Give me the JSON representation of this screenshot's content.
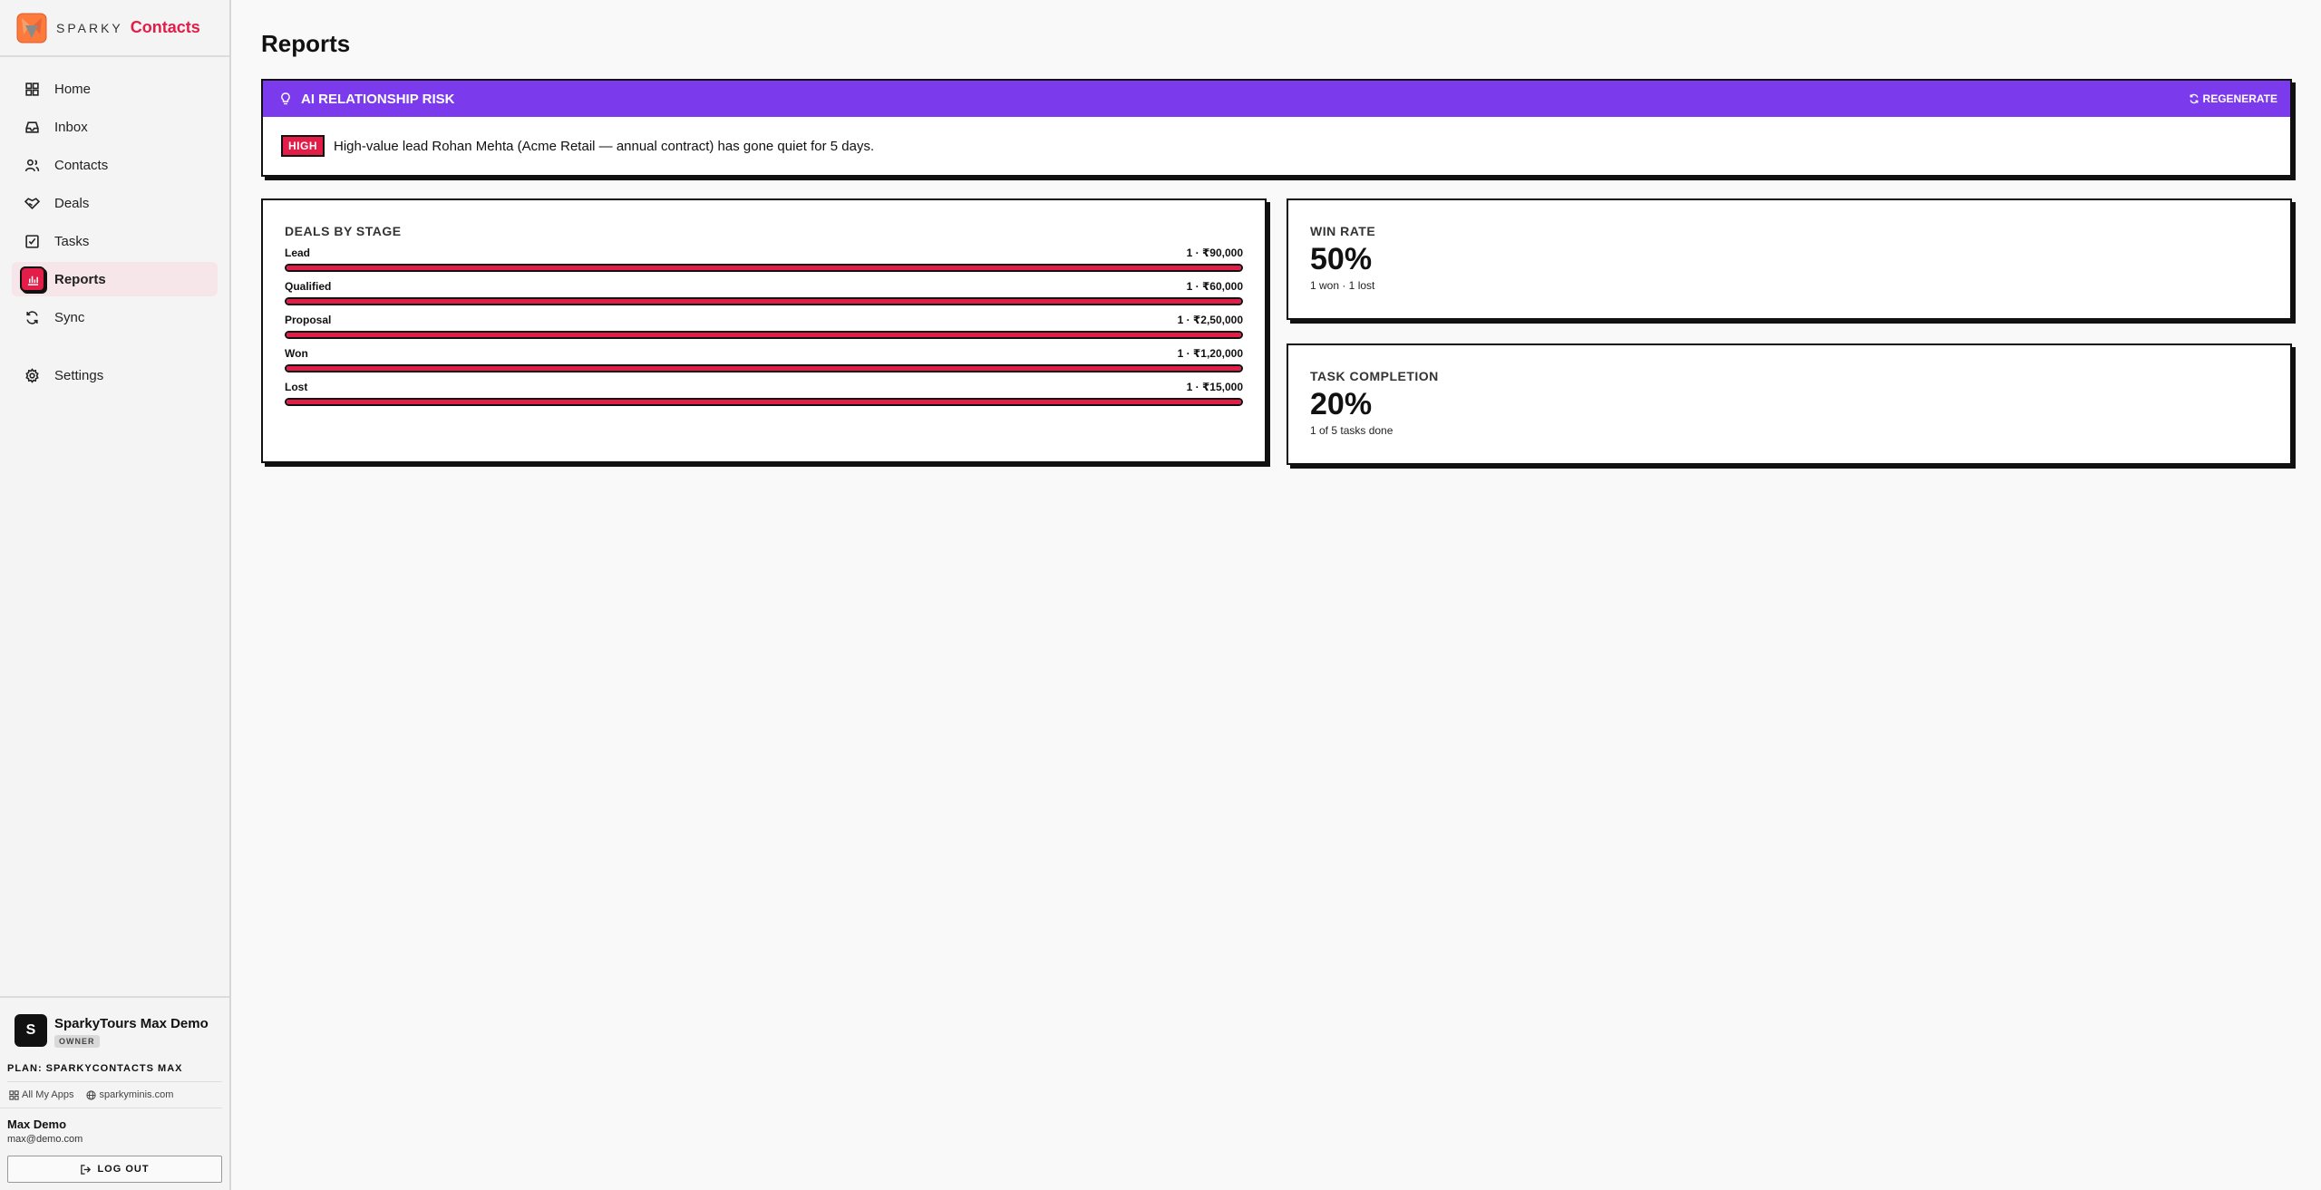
{
  "brand": {
    "sparky": "SPARKY",
    "app": "Contacts"
  },
  "nav": [
    {
      "label": "Home",
      "icon": "home-icon"
    },
    {
      "label": "Inbox",
      "icon": "inbox-icon"
    },
    {
      "label": "Contacts",
      "icon": "users-icon"
    },
    {
      "label": "Deals",
      "icon": "handshake-icon"
    },
    {
      "label": "Tasks",
      "icon": "checkbox-icon"
    },
    {
      "label": "Reports",
      "icon": "bar-chart-icon",
      "active": true
    },
    {
      "label": "Sync",
      "icon": "refresh-icon"
    }
  ],
  "settings_label": "Settings",
  "workspace": {
    "initial": "S",
    "name": "SparkyTours Max Demo",
    "role": "OWNER"
  },
  "plan": "PLAN: SPARKYCONTACTS MAX",
  "links": {
    "apps": "All My Apps",
    "site": "sparkyminis.com"
  },
  "user": {
    "name": "Max Demo",
    "email": "max@demo.com"
  },
  "logout": "LOG OUT",
  "page_title": "Reports",
  "ai": {
    "title": "AI RELATIONSHIP RISK",
    "regenerate": "REGENERATE",
    "badge": "HIGH",
    "message": "High-value lead Rohan Mehta (Acme Retail — annual contract) has gone quiet for 5 days."
  },
  "deals": {
    "title": "DEALS BY STAGE",
    "stages": [
      {
        "name": "Lead",
        "value": "1 · ₹90,000",
        "fill": 1.0
      },
      {
        "name": "Qualified",
        "value": "1 · ₹60,000",
        "fill": 1.0
      },
      {
        "name": "Proposal",
        "value": "1 · ₹2,50,000",
        "fill": 1.0
      },
      {
        "name": "Won",
        "value": "1 · ₹1,20,000",
        "fill": 1.0
      },
      {
        "name": "Lost",
        "value": "1 · ₹15,000",
        "fill": 1.0
      }
    ]
  },
  "win_rate": {
    "title": "WIN RATE",
    "value": "50%",
    "sub": "1 won · 1 lost"
  },
  "task_completion": {
    "title": "TASK COMPLETION",
    "value": "20%",
    "sub": "1 of 5 tasks done"
  },
  "colors": {
    "accent": "#e11d48",
    "ai_header": "#7c3aed"
  }
}
